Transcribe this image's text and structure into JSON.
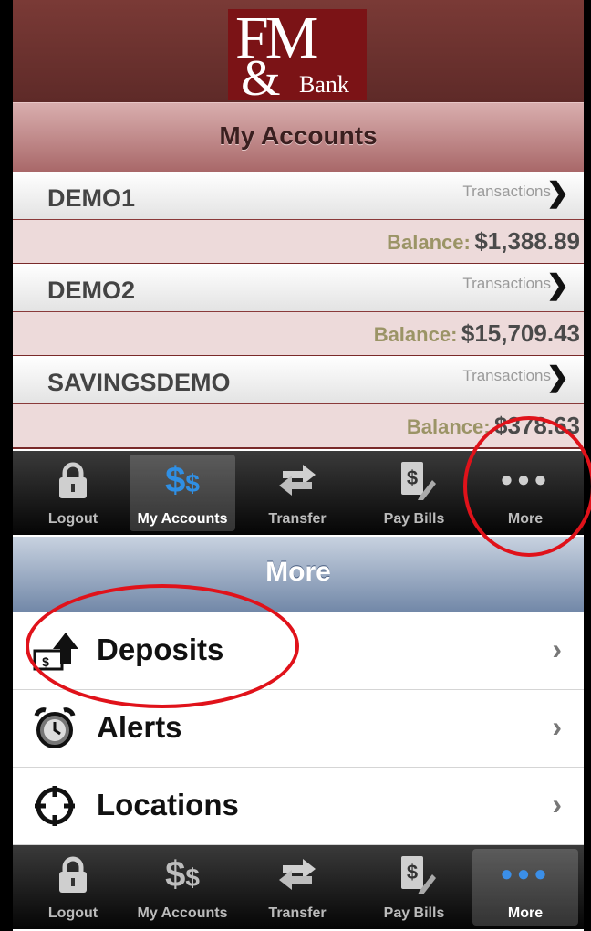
{
  "bank": {
    "logo_fm": "FM",
    "logo_amp": "&",
    "logo_bank": "Bank"
  },
  "accounts_screen": {
    "title": "My Accounts",
    "transactions_label": "Transactions",
    "balance_label": "Balance:",
    "accounts": [
      {
        "name": "DEMO1",
        "balance": "$1,388.89"
      },
      {
        "name": "DEMO2",
        "balance": "$15,709.43"
      },
      {
        "name": "SAVINGSDEMO",
        "balance": "$378.63"
      }
    ]
  },
  "tabbar": {
    "tabs": [
      {
        "label": "Logout",
        "icon": "lock-icon"
      },
      {
        "label": "My Accounts",
        "icon": "dollar-icon"
      },
      {
        "label": "Transfer",
        "icon": "transfer-arrows-icon"
      },
      {
        "label": "Pay Bills",
        "icon": "pay-bills-icon"
      },
      {
        "label": "More",
        "icon": "more-dots-icon"
      }
    ],
    "top_selected": "My Accounts",
    "bottom_selected": "More"
  },
  "more_screen": {
    "title": "More",
    "items": [
      {
        "label": "Deposits",
        "icon": "deposit-upload-icon"
      },
      {
        "label": "Alerts",
        "icon": "alarm-clock-icon"
      },
      {
        "label": "Locations",
        "icon": "crosshair-icon"
      }
    ]
  },
  "colors": {
    "header_maroon": "#6b302d",
    "balance_label": "#9b9466",
    "selected_blue": "#2f8fe4",
    "annotation_red": "#e0121a"
  }
}
